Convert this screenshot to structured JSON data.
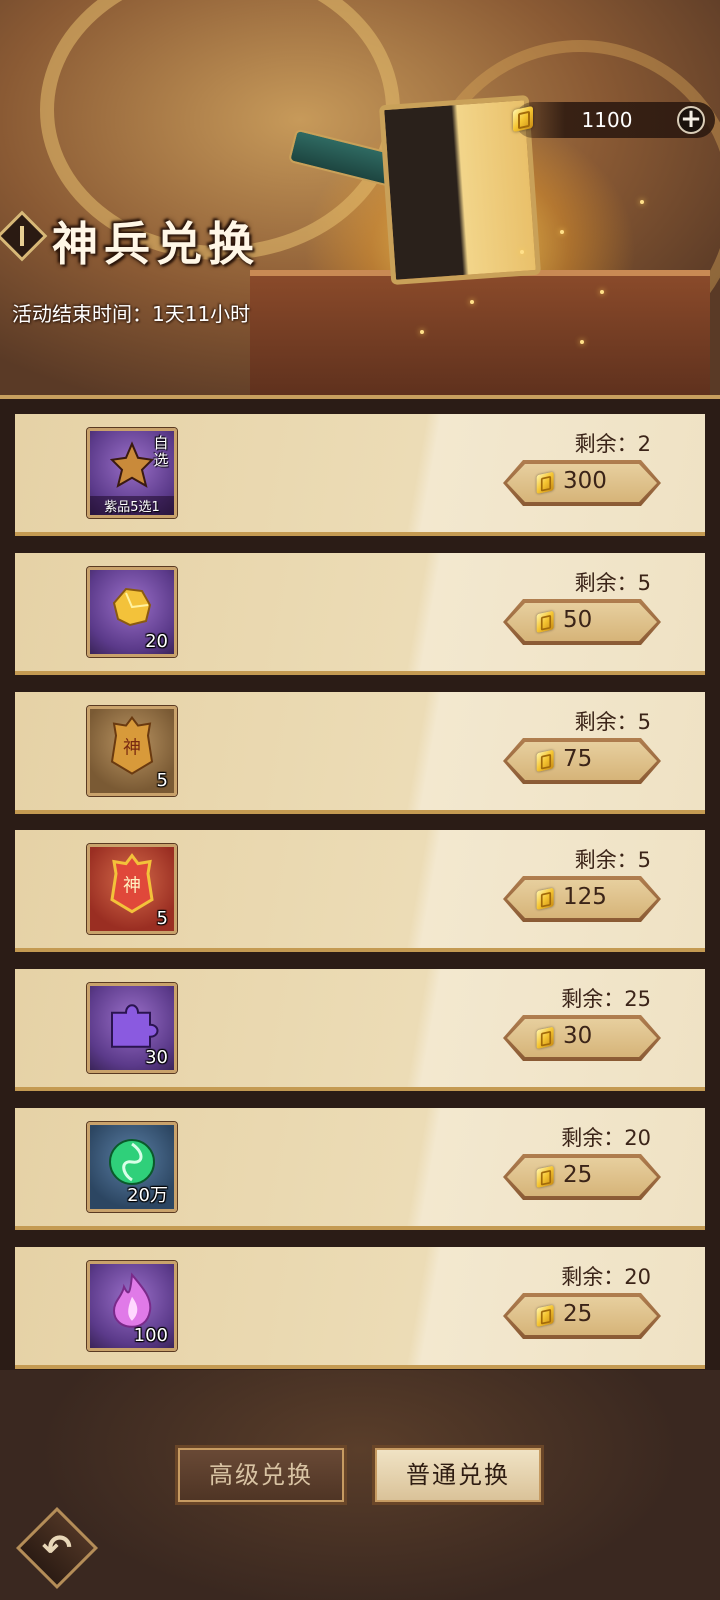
{
  "header": {
    "title": "神兵兑换",
    "timer_text": "活动结束时间：1天11小时",
    "currency": {
      "amount": "1100",
      "icon": "gold-ingot-icon",
      "add_icon": "plus-icon"
    }
  },
  "items": [
    {
      "icon": "purple-weapon-chest-icon",
      "tag_top": "自选",
      "tag_bottom": "紫品5选1",
      "count": "",
      "remaining": "剩余：2",
      "price": "300"
    },
    {
      "icon": "gold-ore-icon",
      "tag_top": "",
      "tag_bottom": "",
      "count": "20",
      "remaining": "剩余：5",
      "price": "50"
    },
    {
      "icon": "gold-divine-emblem-icon",
      "tag_top": "",
      "tag_bottom": "",
      "count": "5",
      "remaining": "剩余：5",
      "price": "75"
    },
    {
      "icon": "red-divine-emblem-icon",
      "tag_top": "",
      "tag_bottom": "",
      "count": "5",
      "remaining": "剩余：5",
      "price": "125"
    },
    {
      "icon": "purple-puzzle-piece-icon",
      "tag_top": "",
      "tag_bottom": "",
      "count": "30",
      "remaining": "剩余：25",
      "price": "30"
    },
    {
      "icon": "green-orb-icon",
      "tag_top": "",
      "tag_bottom": "",
      "count": "20万",
      "remaining": "剩余：20",
      "price": "25"
    },
    {
      "icon": "purple-flame-icon",
      "tag_top": "",
      "tag_bottom": "",
      "count": "100",
      "remaining": "剩余：20",
      "price": "25"
    }
  ],
  "tabs": {
    "advanced": "高级兑换",
    "normal": "普通兑换",
    "active": "normal"
  },
  "nav": {
    "back_icon": "back-arrow-icon"
  },
  "colors": {
    "accent_gold": "#c9a159",
    "row_bg": "#ecdcb6",
    "text_dark": "#3b2418"
  }
}
